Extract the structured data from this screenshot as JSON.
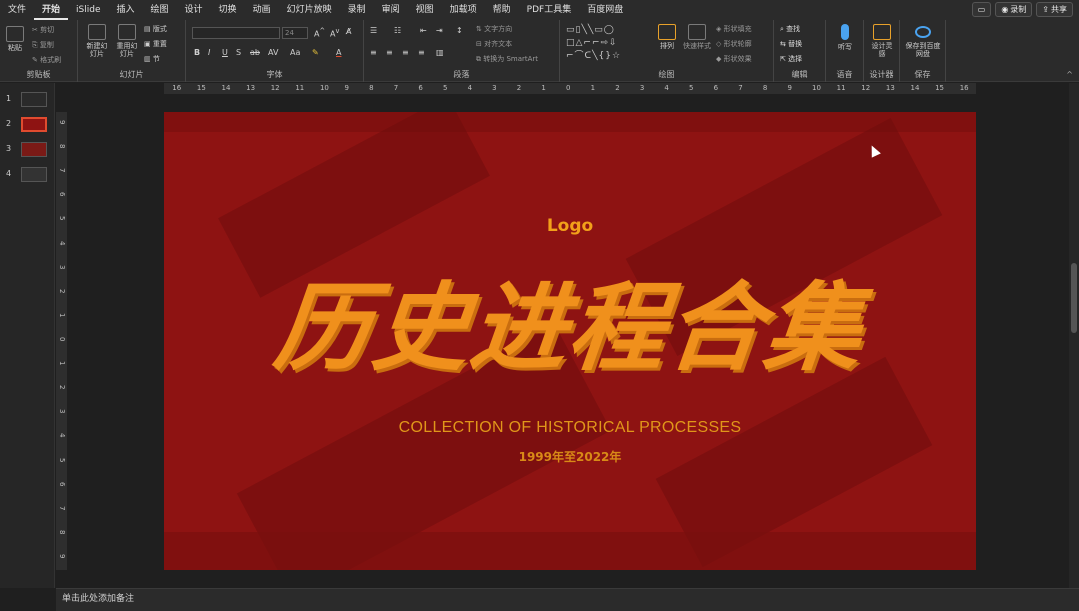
{
  "menu": {
    "tabs": [
      "文件",
      "开始",
      "iSlide",
      "插入",
      "绘图",
      "设计",
      "切换",
      "动画",
      "幻灯片放映",
      "录制",
      "审阅",
      "视图",
      "加载项",
      "帮助",
      "PDF工具集",
      "百度网盘"
    ],
    "active_tab": "开始",
    "comment_icon": "comment-icon",
    "record_label": "录制",
    "share_label": "共享"
  },
  "ribbon": {
    "clipboard": {
      "paste": "粘贴",
      "cut": "剪切",
      "copy": "复制",
      "format_painter": "格式刷",
      "label": "剪贴板"
    },
    "slides": {
      "new_slide": "新建幻灯片",
      "reuse_slide": "重用幻灯片",
      "layout": "版式",
      "reset": "重置",
      "section": "节",
      "label": "幻灯片"
    },
    "font": {
      "size": "24",
      "label": "字体",
      "buttons": [
        "B",
        "I",
        "U",
        "S",
        "ab",
        "AV",
        "Aa",
        "A"
      ]
    },
    "paragraph": {
      "text_direction": "文字方向",
      "align_text": "对齐文本",
      "smartart": "转换为 SmartArt",
      "label": "段落"
    },
    "drawing": {
      "arrange": "排列",
      "quick_styles": "快速样式",
      "shape_fill": "形状填充",
      "shape_outline": "形状轮廓",
      "shape_effects": "形状效果",
      "label": "绘图"
    },
    "editing": {
      "find": "查找",
      "replace": "替换",
      "select": "选择",
      "label": "编辑"
    },
    "voice": {
      "dictate": "听写",
      "label": "语音"
    },
    "designer": {
      "design_ideas": "设计灵感",
      "label": "设计器"
    },
    "save": {
      "save_to_baidu": "保存到百度网盘",
      "label": "保存"
    }
  },
  "thumbnails": [
    "1",
    "2",
    "3",
    "4"
  ],
  "selected_slide": 2,
  "ruler_h": [
    "16",
    "15",
    "14",
    "13",
    "12",
    "11",
    "10",
    "9",
    "8",
    "7",
    "6",
    "5",
    "4",
    "3",
    "2",
    "1",
    "0",
    "1",
    "2",
    "3",
    "4",
    "5",
    "6",
    "7",
    "8",
    "9",
    "10",
    "11",
    "12",
    "13",
    "14",
    "15",
    "16"
  ],
  "ruler_v": [
    "9",
    "8",
    "7",
    "6",
    "5",
    "4",
    "3",
    "2",
    "1",
    "0",
    "1",
    "2",
    "3",
    "4",
    "5",
    "6",
    "7",
    "8",
    "9"
  ],
  "slide": {
    "logo": "Logo",
    "title": "历史进程合集",
    "subtitle": "COLLECTION OF HISTORICAL PROCESSES",
    "years": "1999年至2022年"
  },
  "notes": {
    "placeholder": "单击此处添加备注"
  },
  "colors": {
    "slide_bg": "#8e1312",
    "title": "#f0901c",
    "accent": "#e04b2f"
  }
}
